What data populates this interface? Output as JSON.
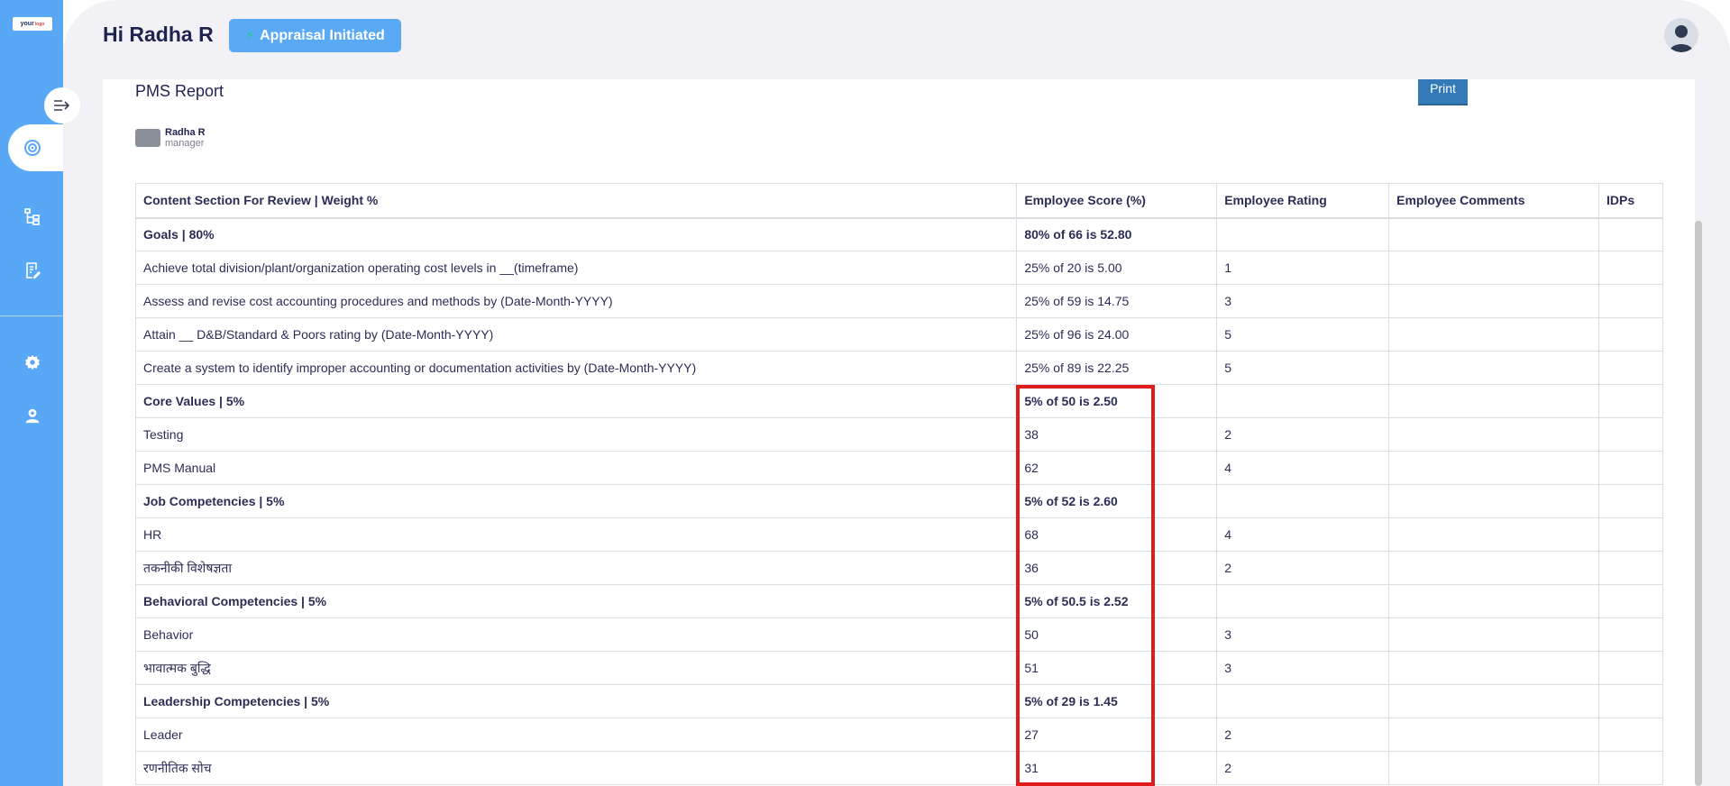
{
  "app": {
    "logo_text": "your",
    "logo_suffix": "logo"
  },
  "header": {
    "greeting": "Hi Radha R",
    "status_label": "Appraisal Initiated",
    "accent_color": "#58a8f5"
  },
  "sidebar": {
    "items": [
      {
        "icon": "collapse-arrow-icon"
      },
      {
        "icon": "target-icon",
        "active": true
      },
      {
        "icon": "org-chart-icon"
      },
      {
        "icon": "document-edit-icon"
      },
      {
        "icon": "gear-icon"
      },
      {
        "icon": "user-icon"
      }
    ]
  },
  "report": {
    "title": "PMS Report",
    "print_label": "Print",
    "person_name": "Radha R",
    "person_role": "manager"
  },
  "table": {
    "headers": [
      "Content Section For Review | Weight %",
      "Employee Score (%)",
      "Employee Rating",
      "Employee Comments",
      "IDPs"
    ],
    "rows": [
      {
        "section": true,
        "title": "Goals | 80%",
        "score": "80% of 66 is 52.80",
        "rating": ""
      },
      {
        "section": false,
        "title": "Achieve total division/plant/organization operating cost levels in __(timeframe)",
        "score": "25% of 20 is 5.00",
        "rating": "1"
      },
      {
        "section": false,
        "title": "Assess and revise cost accounting procedures and methods by (Date-Month-YYYY)",
        "score": "25% of 59 is 14.75",
        "rating": "3"
      },
      {
        "section": false,
        "title": "Attain __ D&B/Standard & Poors rating by (Date-Month-YYYY)",
        "score": "25% of 96 is 24.00",
        "rating": "5"
      },
      {
        "section": false,
        "title": "Create a system to identify improper accounting or documentation activities by (Date-Month-YYYY)",
        "score": "25% of 89 is 22.25",
        "rating": "5"
      },
      {
        "section": true,
        "title": "Core Values | 5%",
        "score": "5% of 50 is 2.50",
        "rating": ""
      },
      {
        "section": false,
        "title": "Testing",
        "score": "38",
        "rating": "2"
      },
      {
        "section": false,
        "title": "PMS Manual",
        "score": "62",
        "rating": "4"
      },
      {
        "section": true,
        "title": "Job Competencies | 5%",
        "score": "5% of 52 is 2.60",
        "rating": ""
      },
      {
        "section": false,
        "title": "HR",
        "score": "68",
        "rating": "4"
      },
      {
        "section": false,
        "title": "तकनीकी विशेषज्ञता",
        "score": "36",
        "rating": "2"
      },
      {
        "section": true,
        "title": "Behavioral Competencies | 5%",
        "score": "5% of 50.5 is 2.52",
        "rating": ""
      },
      {
        "section": false,
        "title": "Behavior",
        "score": "50",
        "rating": "3"
      },
      {
        "section": false,
        "title": "भावात्मक बुद्धि",
        "score": "51",
        "rating": "3"
      },
      {
        "section": true,
        "title": "Leadership Competencies | 5%",
        "score": "5% of 29 is 1.45",
        "rating": ""
      },
      {
        "section": false,
        "title": "Leader",
        "score": "27",
        "rating": "2"
      },
      {
        "section": false,
        "title": "रणनीतिक सोच",
        "score": "31",
        "rating": "2"
      }
    ]
  }
}
